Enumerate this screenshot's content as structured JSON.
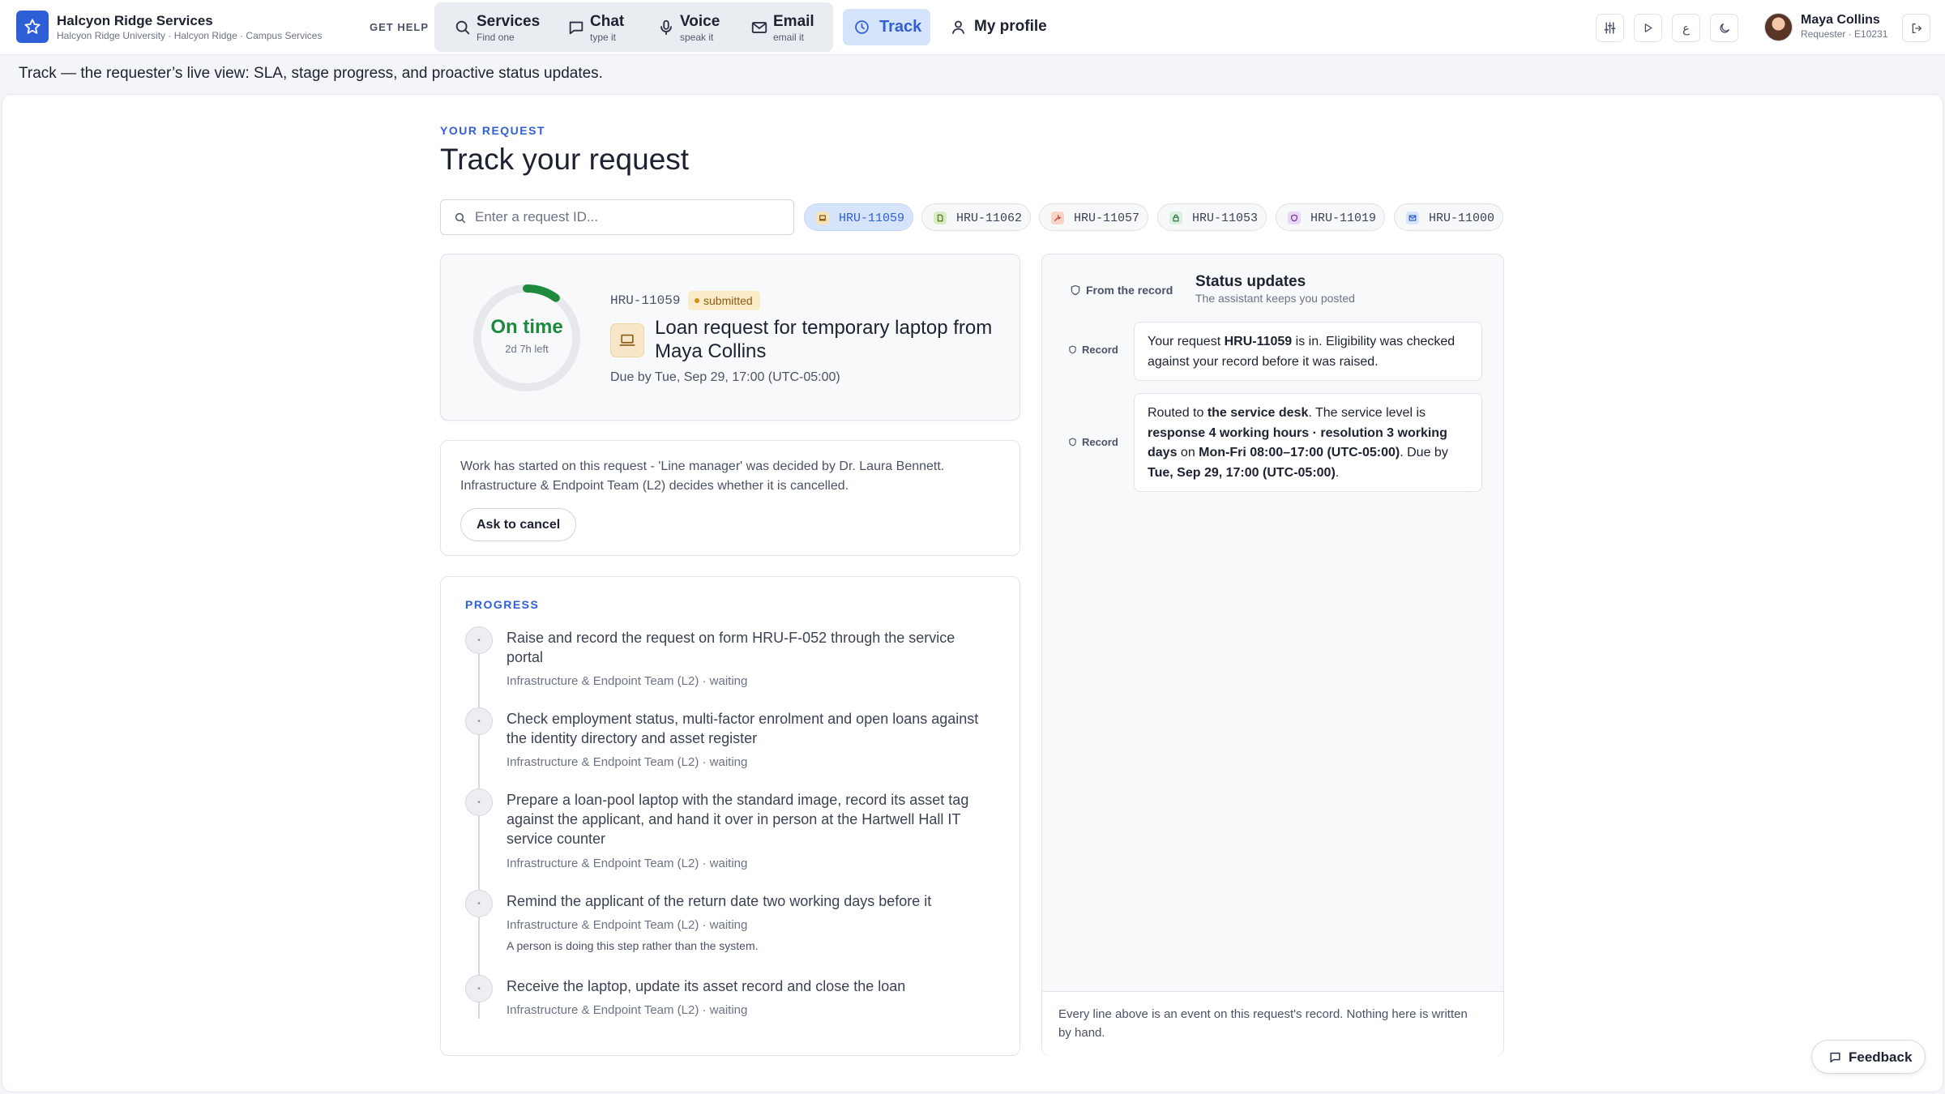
{
  "app": {
    "name": "Halcyon Ridge Services",
    "subtitle": "Halcyon Ridge University · Halcyon Ridge · Campus Services"
  },
  "nav": {
    "get_help": "GET HELP",
    "channels": [
      {
        "title": "Services",
        "sub": "Find one",
        "icon": "search-icon"
      },
      {
        "title": "Chat",
        "sub": "type it",
        "icon": "chat-bubble-icon"
      },
      {
        "title": "Voice",
        "sub": "speak it",
        "icon": "microphone-icon"
      },
      {
        "title": "Email",
        "sub": "email it",
        "icon": "envelope-icon"
      }
    ],
    "track": "Track",
    "profile": "My profile",
    "tools": [
      {
        "icon": "sliders-icon"
      },
      {
        "icon": "play-icon"
      },
      {
        "icon": "language-icon",
        "glyph": "ع"
      },
      {
        "icon": "moon-icon"
      }
    ]
  },
  "user": {
    "name": "Maya Collins",
    "role": "Requester · E10231"
  },
  "caption": "Track — the requester’s live view: SLA, stage progress, and proactive status updates.",
  "page": {
    "eyebrow": "YOUR REQUEST",
    "title": "Track your request",
    "search_placeholder": "Enter a request ID..."
  },
  "recent_requests": [
    {
      "id": "HRU-11059",
      "icon": "laptop-icon",
      "icon_bg": "#f6e3b8",
      "active": true
    },
    {
      "id": "HRU-11062",
      "icon": "document-icon",
      "icon_bg": "#dcebc6",
      "active": false
    },
    {
      "id": "HRU-11057",
      "icon": "wrench-icon",
      "icon_bg": "#f8d3c6",
      "active": false
    },
    {
      "id": "HRU-11053",
      "icon": "lock-icon",
      "icon_bg": "#d9f0dd",
      "active": false
    },
    {
      "id": "HRU-11019",
      "icon": "shield-icon",
      "icon_bg": "#ead7f3",
      "active": false
    },
    {
      "id": "HRU-11000",
      "icon": "envelope-icon",
      "icon_bg": "#d8e5f7",
      "active": false
    }
  ],
  "request": {
    "sla_label": "On time",
    "sla_remaining": "2d 7h left",
    "sla_elapsed_fraction": 0.1,
    "id": "HRU-11059",
    "status": "submitted",
    "title": "Loan request for temporary laptop from Maya Collins",
    "due": "Due by Tue, Sep 29, 17:00 (UTC-05:00)"
  },
  "notice": {
    "text": "Work has started on this request - 'Line manager' was decided by Dr. Laura Bennett. Infrastructure & Endpoint Team (L2) decides whether it is cancelled.",
    "cancel_label": "Ask to cancel"
  },
  "progress": {
    "heading": "PROGRESS",
    "steps": [
      {
        "title": "Raise and record the request on form HRU-F-052 through the service portal",
        "meta": "Infrastructure & Endpoint Team (L2) · waiting",
        "note": ""
      },
      {
        "title": "Check employment status, multi-factor enrolment and open loans against the identity directory and asset register",
        "meta": "Infrastructure & Endpoint Team (L2) · waiting",
        "note": ""
      },
      {
        "title": "Prepare a loan-pool laptop with the standard image, record its asset tag against the applicant, and hand it over in person at the Hartwell Hall IT service counter",
        "meta": "Infrastructure & Endpoint Team (L2) · waiting",
        "note": ""
      },
      {
        "title": "Remind the applicant of the return date two working days before it",
        "meta": "Infrastructure & Endpoint Team (L2) · waiting",
        "note": "A person is doing this step rather than the system."
      },
      {
        "title": "Receive the laptop, update its asset record and close the loan",
        "meta": "Infrastructure & Endpoint Team (L2) · waiting",
        "note": ""
      }
    ]
  },
  "updates": {
    "tab_label": "From the record",
    "title": "Status updates",
    "subtitle": "The assistant keeps you posted",
    "record_label": "Record",
    "messages": [
      {
        "pre": "Your request ",
        "b1": "HRU-11059",
        "mid": " is in. Eligibility was checked against your record before it was raised."
      },
      {
        "pre": "Routed to ",
        "b1": "the service desk",
        "mid": ". The service level is ",
        "b2": "response 4 working hours · resolution 3 working days",
        "mid2": " on ",
        "b3": "Mon-Fri 08:00–17:00 (UTC-05:00)",
        "mid3": ". Due by ",
        "b4": "Tue, Sep 29, 17:00 (UTC-05:00)",
        "end": "."
      }
    ],
    "footer": "Every line above is an event on this request's record. Nothing here is written by hand."
  },
  "feedback_label": "Feedback",
  "colors": {
    "accent": "#2f5fd6",
    "on_time": "#1e8a3e",
    "status_badge": "#fbecc9"
  }
}
